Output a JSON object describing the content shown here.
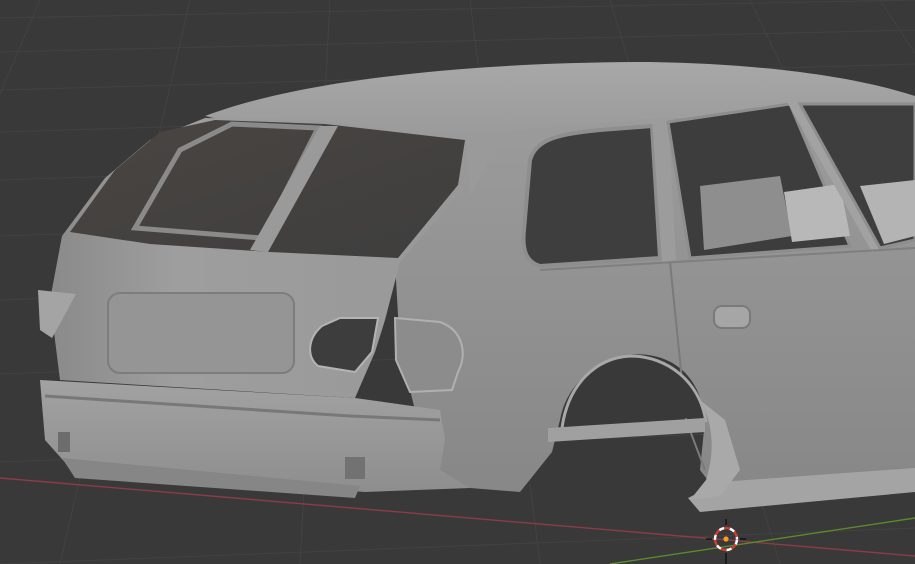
{
  "app": {
    "name": "3D Viewport",
    "background": "#393939"
  },
  "viewport": {
    "grid_visible": true,
    "grid_color": "#424242",
    "x_axis_color": "#8c3c48",
    "y_axis_color": "#5c8a2c",
    "object": {
      "kind": "car-body-shell",
      "shading": "solid",
      "base_color": "#9a9a9a"
    },
    "cursor": {
      "icon": "3d-cursor-icon",
      "ring_colors": [
        "#d23b30",
        "#ffffff"
      ],
      "origin_color": "#ff9a1a"
    }
  }
}
